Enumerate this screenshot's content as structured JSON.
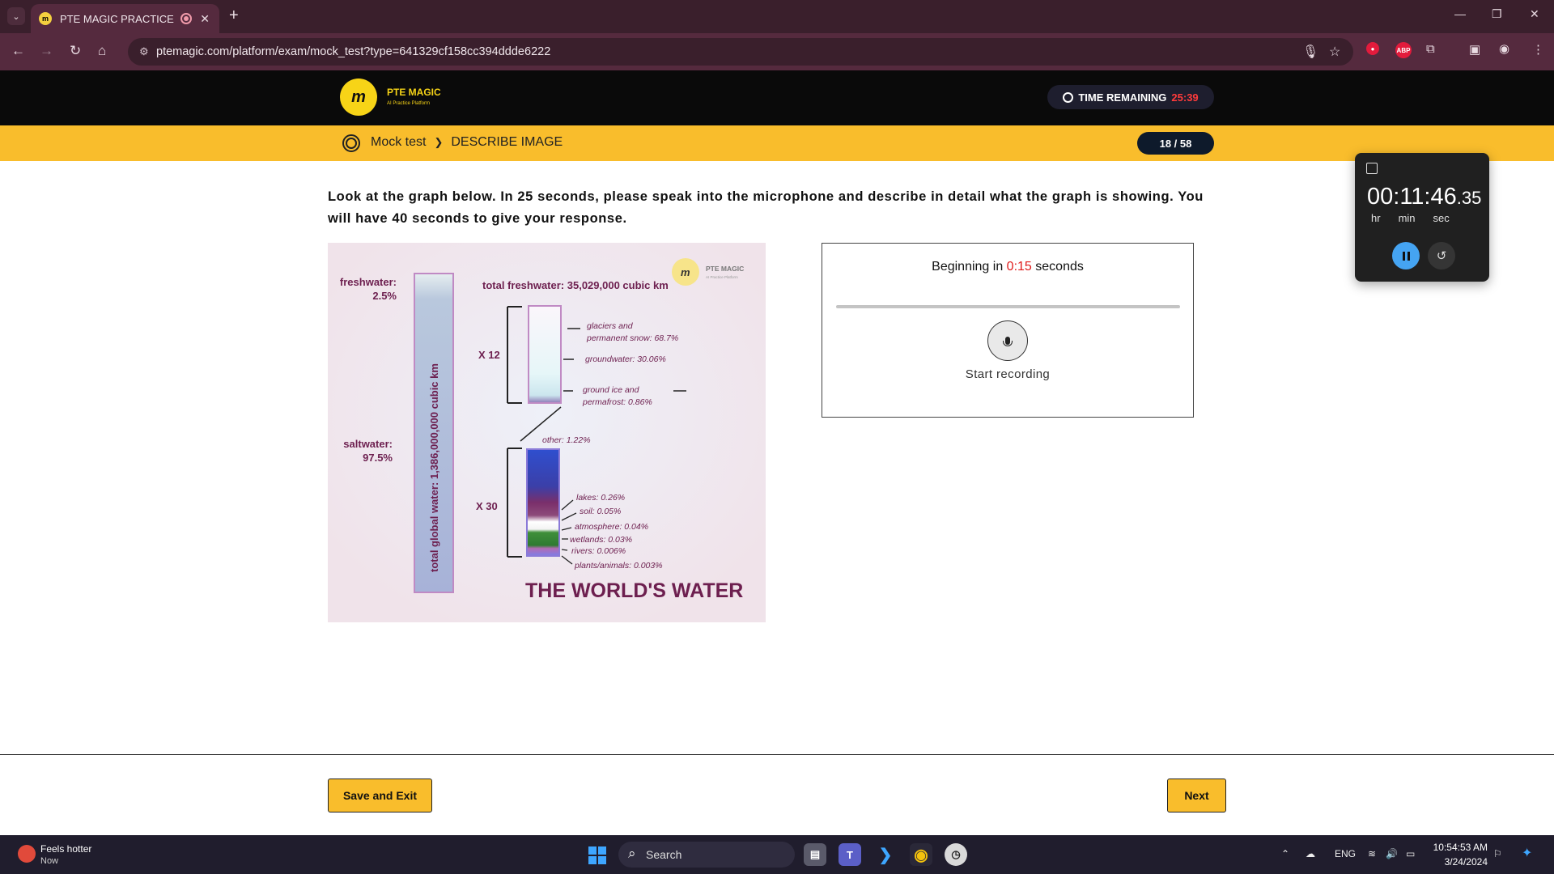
{
  "browser": {
    "tab_title": "PTE MAGIC PRACTICE",
    "url": "ptemagic.com/platform/exam/mock_test?type=641329cf158cc394ddde6222"
  },
  "header": {
    "brand": "PTE MAGIC",
    "brand_sub": "AI Practice Platform",
    "timer_label": "TIME REMAINING",
    "timer_value": "25:39"
  },
  "breadcrumb": {
    "root": "Mock test",
    "current": "DESCRIBE IMAGE",
    "progress": "18 / 58"
  },
  "instruction": "Look at the graph below. In 25 seconds, please speak into the microphone and describe in detail what the graph is showing. You will have 40 seconds to give your response.",
  "figure": {
    "brand": "PTE MAGIC",
    "brand_sub": "AI Practice Platform",
    "freshwater_label": "freshwater:",
    "freshwater_pct": "2.5%",
    "saltwater_label": "saltwater:",
    "saltwater_pct": "97.5%",
    "total_label": "total global water: 1,386,000,000 cubic km",
    "fresh_total": "total freshwater: 35,029,000 cubic km",
    "x12": "X 12",
    "x30": "X 30",
    "title": "THE WORLD'S WATER",
    "fresh_items": [
      {
        "l1": "glaciers and",
        "l2": "permanent snow: 68.7%"
      },
      {
        "l1": "groundwater: 30.06%",
        "l2": ""
      },
      {
        "l1": "ground ice and",
        "l2": "permafrost: 0.86%"
      }
    ],
    "other_label": "other: 1.22%",
    "other_items": [
      "lakes: 0.26%",
      "soil: 0.05%",
      "atmosphere: 0.04%",
      "wetlands: 0.03%",
      "rivers: 0.006%",
      "plants/animals: 0.003%"
    ]
  },
  "recorder": {
    "status_prefix": "Beginning in",
    "status_time": "0:15",
    "status_suffix": "seconds",
    "start_label": "Start recording"
  },
  "stopwatch": {
    "main": "00:11:46",
    "fraction": ".35",
    "labels": [
      "hr",
      "min",
      "sec"
    ]
  },
  "footer": {
    "save_label": "Save and Exit",
    "next_label": "Next"
  },
  "taskbar": {
    "weather_title": "Feels hotter",
    "weather_sub": "Now",
    "search": "Search",
    "lang": "ENG",
    "time": "10:54:53 AM",
    "date": "3/24/2024"
  },
  "colors": {
    "accent": "#f9bd2c",
    "timer_red": "#ff3b3b",
    "figure_text": "#6d1f4f"
  }
}
